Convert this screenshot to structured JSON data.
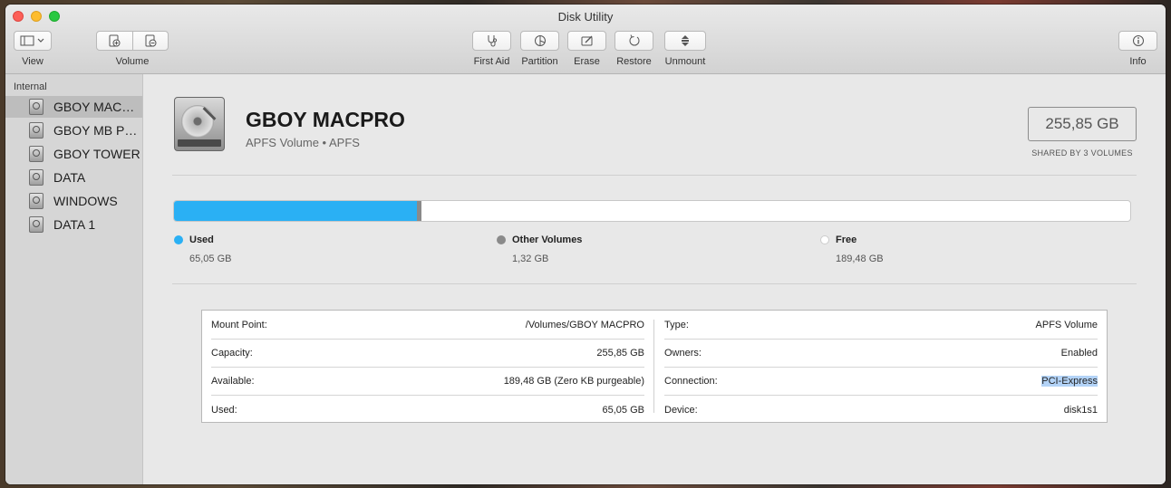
{
  "window": {
    "title": "Disk Utility"
  },
  "toolbar": {
    "view_label": "View",
    "volume_label": "Volume",
    "first_aid_label": "First Aid",
    "partition_label": "Partition",
    "erase_label": "Erase",
    "restore_label": "Restore",
    "unmount_label": "Unmount",
    "info_label": "Info"
  },
  "sidebar": {
    "section": "Internal",
    "items": [
      {
        "label": "GBOY MACPRO",
        "selected": true
      },
      {
        "label": "GBOY MB PRO",
        "selected": false
      },
      {
        "label": "GBOY TOWER",
        "selected": false
      },
      {
        "label": "DATA",
        "selected": false
      },
      {
        "label": "WINDOWS",
        "selected": false
      },
      {
        "label": "DATA 1",
        "selected": false
      }
    ]
  },
  "volume": {
    "name": "GBOY MACPRO",
    "subtitle": "APFS Volume • APFS",
    "size": "255,85 GB",
    "shared": "SHARED BY 3 VOLUMES"
  },
  "usage": {
    "used_fraction": 0.254,
    "other_fraction": 0.005,
    "colors": {
      "used": "#2ab0f4",
      "other": "#8a8a8a",
      "free": "#ffffff"
    },
    "legend": [
      {
        "name": "Used",
        "value": "65,05 GB",
        "color": "#2ab0f4"
      },
      {
        "name": "Other Volumes",
        "value": "1,32 GB",
        "color": "#8a8a8a"
      },
      {
        "name": "Free",
        "value": "189,48 GB",
        "color": "#ffffff"
      }
    ]
  },
  "info": {
    "left": [
      {
        "label": "Mount Point:",
        "value": "/Volumes/GBOY MACPRO"
      },
      {
        "label": "Capacity:",
        "value": "255,85 GB"
      },
      {
        "label": "Available:",
        "value": "189,48 GB (Zero KB purgeable)"
      },
      {
        "label": "Used:",
        "value": "65,05 GB"
      }
    ],
    "right": [
      {
        "label": "Type:",
        "value": "APFS Volume"
      },
      {
        "label": "Owners:",
        "value": "Enabled"
      },
      {
        "label": "Connection:",
        "value": "PCI-Express",
        "highlighted": true
      },
      {
        "label": "Device:",
        "value": "disk1s1"
      }
    ]
  }
}
